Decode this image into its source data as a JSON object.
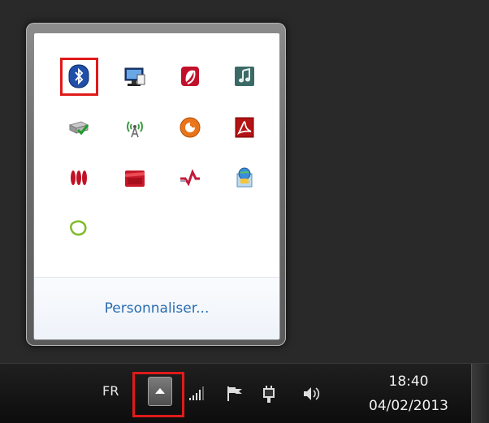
{
  "tray_popup": {
    "icons": [
      {
        "name": "bluetooth-icon"
      },
      {
        "name": "display-settings-icon"
      },
      {
        "name": "red-app-icon"
      },
      {
        "name": "music-icon"
      },
      {
        "name": "device-ok-icon"
      },
      {
        "name": "wireless-icon"
      },
      {
        "name": "orange-circle-icon"
      },
      {
        "name": "acrobat-icon"
      },
      {
        "name": "red-bars-icon"
      },
      {
        "name": "red-folder-icon"
      },
      {
        "name": "red-chart-icon"
      },
      {
        "name": "network-globe-icon"
      },
      {
        "name": "green-blob-icon"
      }
    ],
    "customize_label": "Personnaliser..."
  },
  "taskbar": {
    "language": "FR",
    "clock_time": "18:40",
    "clock_date": "04/02/2013"
  },
  "colors": {
    "highlight": "#e01a1a",
    "link": "#2a6cb0"
  }
}
